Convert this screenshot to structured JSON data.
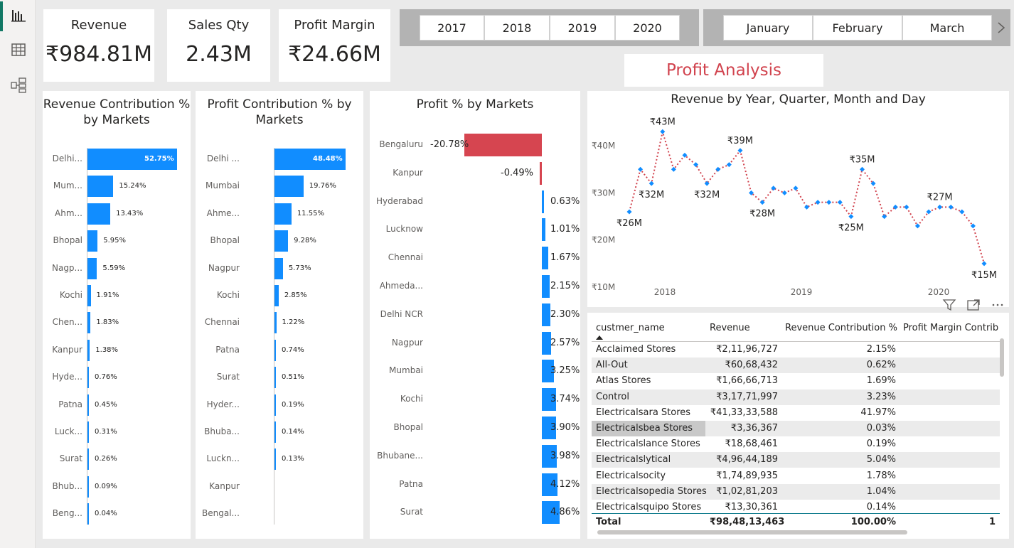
{
  "nav": {
    "items": [
      {
        "name": "report-view-icon"
      },
      {
        "name": "table-view-icon"
      },
      {
        "name": "model-view-icon"
      }
    ]
  },
  "kpis": [
    {
      "label": "Revenue",
      "value": "₹984.81M"
    },
    {
      "label": "Sales Qty",
      "value": "2.43M"
    },
    {
      "label": "Profit Margin",
      "value": "₹24.66M"
    }
  ],
  "year_slicer": [
    "2017",
    "2018",
    "2019",
    "2020"
  ],
  "month_slicer": [
    "January",
    "February",
    "March"
  ],
  "page_title": "Profit Analysis",
  "revenue_contribution": {
    "title": "Revenue Contribution % by Markets",
    "rows": [
      {
        "label": "Delhi...",
        "value": 52.75,
        "text": "52.75%"
      },
      {
        "label": "Mum...",
        "value": 15.24,
        "text": "15.24%"
      },
      {
        "label": "Ahm...",
        "value": 13.43,
        "text": "13.43%"
      },
      {
        "label": "Bhopal",
        "value": 5.95,
        "text": "5.95%"
      },
      {
        "label": "Nagp...",
        "value": 5.59,
        "text": "5.59%"
      },
      {
        "label": "Kochi",
        "value": 1.91,
        "text": "1.91%"
      },
      {
        "label": "Chen...",
        "value": 1.83,
        "text": "1.83%"
      },
      {
        "label": "Kanpur",
        "value": 1.38,
        "text": "1.38%"
      },
      {
        "label": "Hyde...",
        "value": 0.76,
        "text": "0.76%"
      },
      {
        "label": "Patna",
        "value": 0.45,
        "text": "0.45%"
      },
      {
        "label": "Luck...",
        "value": 0.31,
        "text": "0.31%"
      },
      {
        "label": "Surat",
        "value": 0.26,
        "text": "0.26%"
      },
      {
        "label": "Bhub...",
        "value": 0.09,
        "text": "0.09%"
      },
      {
        "label": "Beng...",
        "value": 0.04,
        "text": "0.04%"
      }
    ]
  },
  "profit_contribution": {
    "title": "Profit Contribution % by Markets",
    "rows": [
      {
        "label": "Delhi ...",
        "value": 48.48,
        "text": "48.48%"
      },
      {
        "label": "Mumbai",
        "value": 19.76,
        "text": "19.76%"
      },
      {
        "label": "Ahme...",
        "value": 11.55,
        "text": "11.55%"
      },
      {
        "label": "Bhopal",
        "value": 9.28,
        "text": "9.28%"
      },
      {
        "label": "Nagpur",
        "value": 5.73,
        "text": "5.73%"
      },
      {
        "label": "Kochi",
        "value": 2.85,
        "text": "2.85%"
      },
      {
        "label": "Chennai",
        "value": 1.22,
        "text": "1.22%"
      },
      {
        "label": "Patna",
        "value": 0.74,
        "text": "0.74%"
      },
      {
        "label": "Surat",
        "value": 0.51,
        "text": "0.51%"
      },
      {
        "label": "Hyder...",
        "value": 0.19,
        "text": "0.19%"
      },
      {
        "label": "Bhuba...",
        "value": 0.14,
        "text": "0.14%"
      },
      {
        "label": "Luckn...",
        "value": 0.13,
        "text": "0.13%"
      },
      {
        "label": "Kanpur",
        "value": 0.0,
        "text": ""
      },
      {
        "label": "Bengal...",
        "value": 0.0,
        "text": ""
      }
    ]
  },
  "profit_pct": {
    "title": "Profit % by Markets",
    "rows": [
      {
        "label": "Bengaluru",
        "value": -20.78,
        "text": "-20.78%"
      },
      {
        "label": "Kanpur",
        "value": -0.49,
        "text": "-0.49%"
      },
      {
        "label": "Hyderabad",
        "value": 0.63,
        "text": "0.63%"
      },
      {
        "label": "Lucknow",
        "value": 1.01,
        "text": "1.01%"
      },
      {
        "label": "Chennai",
        "value": 1.67,
        "text": "1.67%"
      },
      {
        "label": "Ahmeda...",
        "value": 2.15,
        "text": "2.15%"
      },
      {
        "label": "Delhi NCR",
        "value": 2.3,
        "text": "2.30%"
      },
      {
        "label": "Nagpur",
        "value": 2.57,
        "text": "2.57%"
      },
      {
        "label": "Mumbai",
        "value": 3.25,
        "text": "3.25%"
      },
      {
        "label": "Kochi",
        "value": 3.74,
        "text": "3.74%"
      },
      {
        "label": "Bhopal",
        "value": 3.9,
        "text": "3.90%"
      },
      {
        "label": "Bhubane...",
        "value": 3.98,
        "text": "3.98%"
      },
      {
        "label": "Patna",
        "value": 4.12,
        "text": "4.12%"
      },
      {
        "label": "Surat",
        "value": 4.86,
        "text": "4.86%"
      }
    ],
    "neg_color": "#d64550",
    "pos_color": "#118dff"
  },
  "chart_data": {
    "type": "line",
    "title": "Revenue by Year, Quarter, Month and Day",
    "ylim": [
      10,
      45
    ],
    "yticks": [
      "₹10M",
      "₹20M",
      "₹30M",
      "₹40M"
    ],
    "xticks": [
      "2018",
      "2019",
      "2020"
    ],
    "series": [
      {
        "values": [
          26,
          35,
          32,
          43,
          35,
          38,
          36,
          32,
          35,
          36,
          39,
          30,
          28,
          31,
          30,
          31,
          27,
          28,
          28,
          28,
          25,
          35,
          32,
          25,
          27,
          27,
          23,
          26,
          27,
          27,
          26,
          23,
          15
        ],
        "color": "#d1434e",
        "marker_color": "#118dff"
      }
    ],
    "data_labels": [
      {
        "index": 0,
        "text": "₹26M"
      },
      {
        "index": 2,
        "text": "₹32M"
      },
      {
        "index": 3,
        "text": "₹43M"
      },
      {
        "index": 7,
        "text": "₹32M"
      },
      {
        "index": 10,
        "text": "₹39M"
      },
      {
        "index": 12,
        "text": "₹28M"
      },
      {
        "index": 20,
        "text": "₹25M"
      },
      {
        "index": 21,
        "text": "₹35M"
      },
      {
        "index": 28,
        "text": "₹27M"
      },
      {
        "index": 32,
        "text": "₹15M"
      }
    ]
  },
  "table": {
    "columns": [
      "custmer_name",
      "Revenue",
      "Revenue Contribution %",
      "Profit Margin Contrib"
    ],
    "rows": [
      [
        "Acclaimed Stores",
        "₹2,11,96,727",
        "2.15%"
      ],
      [
        "All-Out",
        "₹60,68,432",
        "0.62%"
      ],
      [
        "Atlas Stores",
        "₹1,66,66,713",
        "1.69%"
      ],
      [
        "Control",
        "₹3,17,71,997",
        "3.23%"
      ],
      [
        "Electricalsara Stores",
        "₹41,33,33,588",
        "41.97%"
      ],
      [
        "Electricalsbea Stores",
        "₹3,36,367",
        "0.03%"
      ],
      [
        "Electricalslance Stores",
        "₹18,68,461",
        "0.19%"
      ],
      [
        "Electricalslytical",
        "₹4,96,44,189",
        "5.04%"
      ],
      [
        "Electricalsocity",
        "₹1,74,89,935",
        "1.78%"
      ],
      [
        "Electricalsopedia Stores",
        "₹1,02,81,203",
        "1.04%"
      ],
      [
        "Electricalsquipo Stores",
        "₹13,30,361",
        "0.14%"
      ]
    ],
    "total": {
      "label": "Total",
      "revenue": "₹98,48,13,463",
      "pct": "100.00%",
      "margin": "1"
    }
  }
}
